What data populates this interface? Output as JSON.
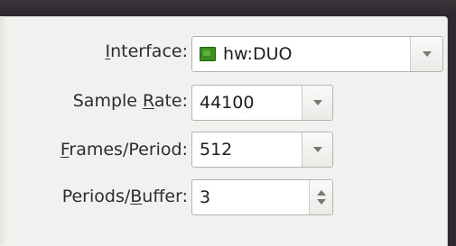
{
  "settings": {
    "interface": {
      "label_pre": "",
      "label_mn": "I",
      "label_post": "nterface:",
      "value": "hw:DUO",
      "icon": "sound-card-icon"
    },
    "sample_rate": {
      "label_pre": "Sample ",
      "label_mn": "R",
      "label_post": "ate:",
      "value": "44100"
    },
    "frames_period": {
      "label_pre": "",
      "label_mn": "F",
      "label_post": "rames/Period:",
      "value": "512"
    },
    "periods_buffer": {
      "label_pre": "Periods/",
      "label_mn": "B",
      "label_post": "uffer:",
      "value": "3"
    }
  }
}
